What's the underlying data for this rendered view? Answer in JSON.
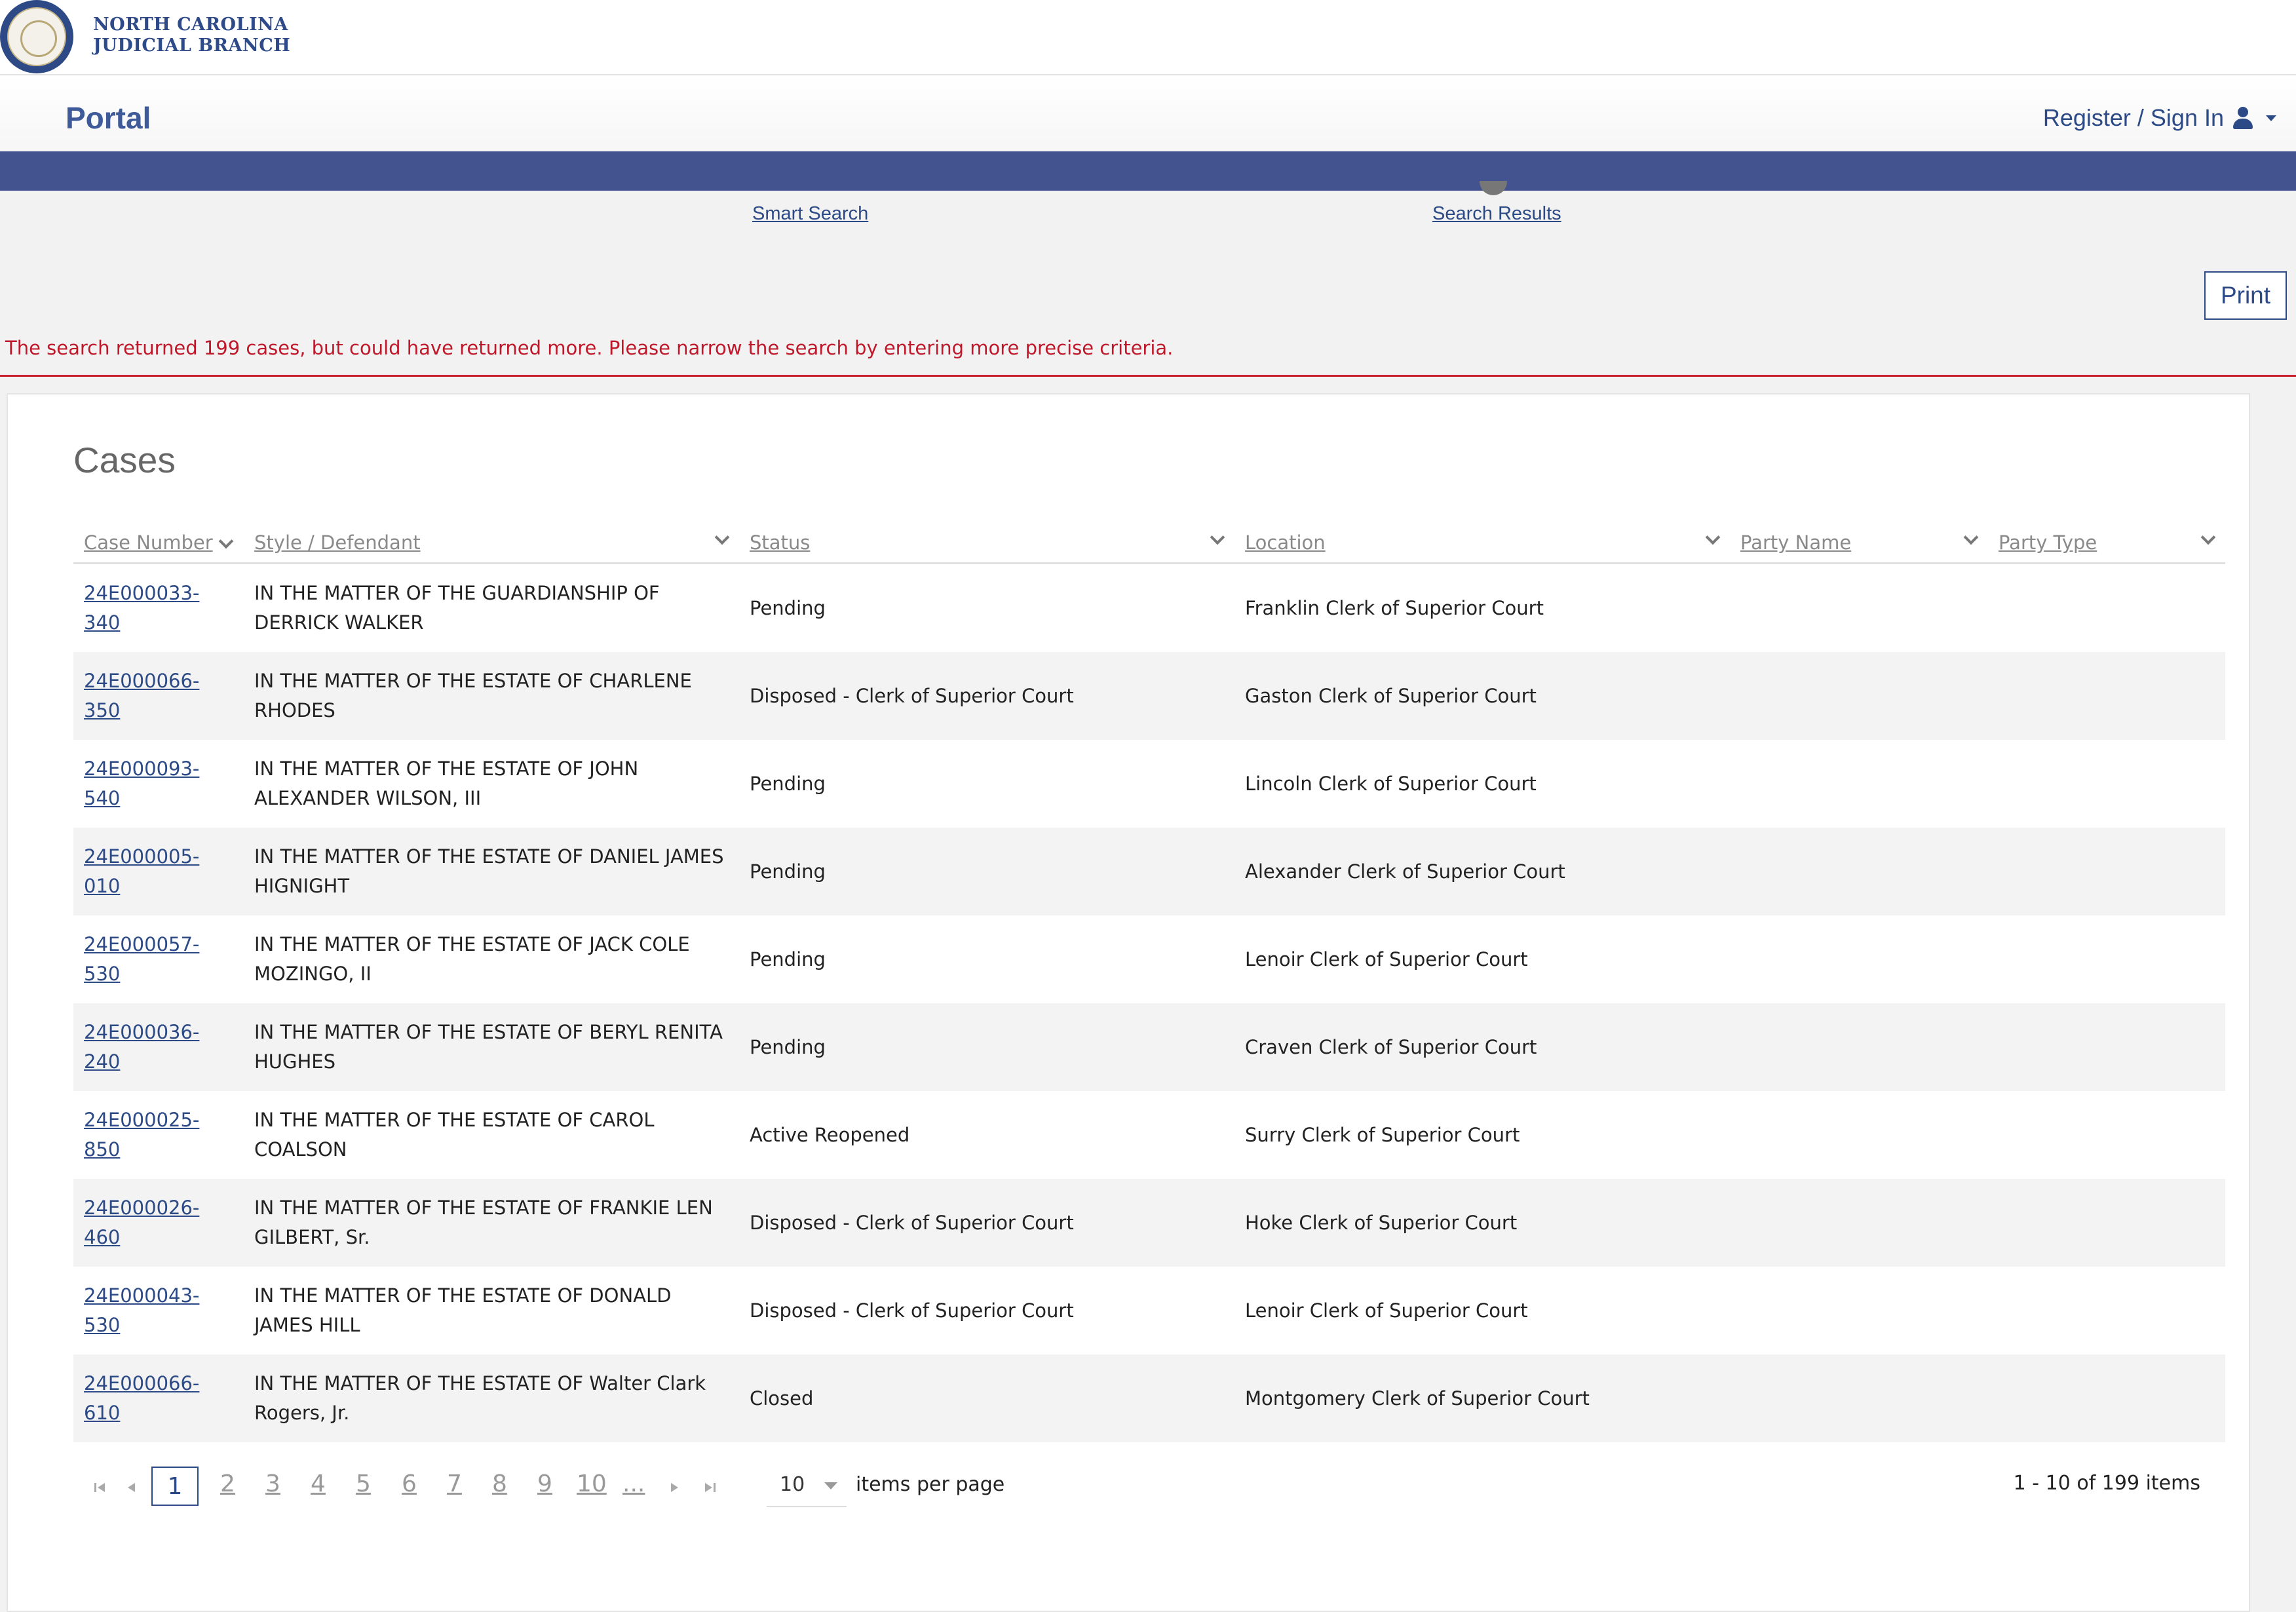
{
  "brand": {
    "line1": "NORTH CAROLINA",
    "line2": "JUDICIAL BRANCH"
  },
  "header": {
    "title": "Portal",
    "signin_label": "Register / Sign In"
  },
  "steps": [
    "Smart Search",
    "Search Results"
  ],
  "print_label": "Print",
  "alert": "The search returned 199 cases, but could have returned more. Please narrow the search by entering more precise criteria.",
  "panel": {
    "title": "Cases"
  },
  "columns": [
    "Case Number",
    "Style / Defendant",
    "Status",
    "Location",
    "Party Name",
    "Party Type"
  ],
  "rows": [
    {
      "case": "24E000033-340",
      "style": "IN THE MATTER OF THE GUARDIANSHIP OF DERRICK WALKER",
      "status": "Pending",
      "location": "Franklin Clerk of Superior Court"
    },
    {
      "case": "24E000066-350",
      "style": "IN THE MATTER OF THE ESTATE OF CHARLENE RHODES",
      "status": "Disposed - Clerk of Superior Court",
      "location": "Gaston Clerk of Superior Court"
    },
    {
      "case": "24E000093-540",
      "style": "IN THE MATTER OF THE ESTATE OF JOHN ALEXANDER WILSON, III",
      "status": "Pending",
      "location": "Lincoln Clerk of Superior Court"
    },
    {
      "case": "24E000005-010",
      "style": "IN THE MATTER OF THE ESTATE OF DANIEL JAMES HIGNIGHT",
      "status": "Pending",
      "location": "Alexander Clerk of Superior Court"
    },
    {
      "case": "24E000057-530",
      "style": "IN THE MATTER OF THE ESTATE OF JACK COLE MOZINGO, II",
      "status": "Pending",
      "location": "Lenoir Clerk of Superior Court"
    },
    {
      "case": "24E000036-240",
      "style": "IN THE MATTER OF THE ESTATE OF BERYL RENITA HUGHES",
      "status": "Pending",
      "location": "Craven Clerk of Superior Court"
    },
    {
      "case": "24E000025-850",
      "style": "IN THE MATTER OF THE ESTATE OF CAROL COALSON",
      "status": "Active Reopened",
      "location": "Surry Clerk of Superior Court"
    },
    {
      "case": "24E000026-460",
      "style": "IN THE MATTER OF THE ESTATE OF FRANKIE LEN GILBERT, Sr.",
      "status": "Disposed - Clerk of Superior Court",
      "location": "Hoke Clerk of Superior Court"
    },
    {
      "case": "24E000043-530",
      "style": "IN THE MATTER OF THE ESTATE OF DONALD JAMES HILL",
      "status": "Disposed - Clerk of Superior Court",
      "location": "Lenoir Clerk of Superior Court"
    },
    {
      "case": "24E000066-610",
      "style": "IN THE MATTER OF THE ESTATE OF Walter Clark Rogers, Jr.",
      "status": "Closed",
      "location": "Montgomery Clerk of Superior Court"
    }
  ],
  "pager": {
    "current": "1",
    "pages": [
      "2",
      "3",
      "4",
      "5",
      "6",
      "7",
      "8",
      "9",
      "10",
      "..."
    ],
    "items_per_page": "10",
    "items_per_page_label": "items per page",
    "range": "1 - 10 of 199 items"
  },
  "colors": {
    "brand_navy": "#425390",
    "link": "#2c4a86",
    "alert": "#c0182b"
  }
}
